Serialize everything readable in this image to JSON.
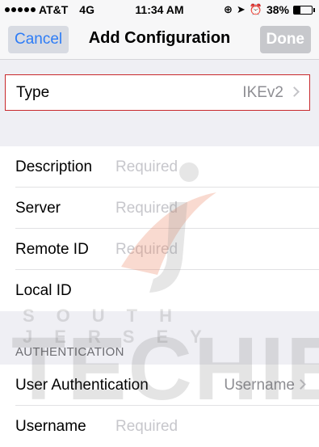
{
  "status_bar": {
    "carrier": "AT&T",
    "network": "4G",
    "time": "11:34 AM",
    "battery": "38%",
    "battery_level": 0.38
  },
  "nav": {
    "cancel_label": "Cancel",
    "title": "Add Configuration",
    "done_label": "Done"
  },
  "type_row": {
    "label": "Type",
    "value": "IKEv2"
  },
  "config_rows": [
    {
      "label": "Description",
      "placeholder": "Required"
    },
    {
      "label": "Server",
      "placeholder": "Required"
    },
    {
      "label": "Remote ID",
      "placeholder": "Required"
    },
    {
      "label": "Local ID",
      "placeholder": ""
    }
  ],
  "authentication": {
    "header": "AUTHENTICATION",
    "rows": [
      {
        "label": "User Authentication",
        "value": "Username"
      },
      {
        "label": "Username",
        "placeholder": "Required"
      }
    ]
  },
  "watermark": {
    "line1": "SOUTH JERSEY",
    "line2": "TECHIES"
  },
  "colors": {
    "accent": "#2d7cf6",
    "highlight_border": "#c8282c",
    "placeholder": "#c7c7cc",
    "secondary": "#8e8e93"
  }
}
